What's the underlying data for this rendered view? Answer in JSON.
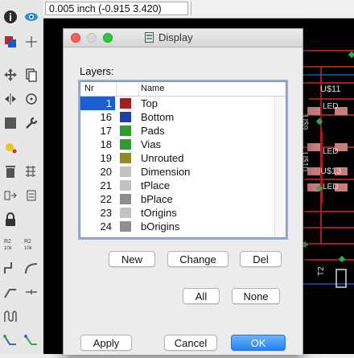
{
  "coordinate_readout": "0.005 inch (-0.915 3.420)",
  "toolbar": {
    "tools": [
      "info-icon",
      "eye-icon",
      "layer-display-icon",
      "mark-icon",
      "move-icon",
      "copy-icon",
      "mirror-icon",
      "rotate-icon",
      "group-icon",
      "change-icon",
      "paste-icon",
      "delete-icon",
      "add-icon",
      "replace-icon",
      "lock-icon",
      "smash-icon",
      "split-icon",
      "optimize-icon",
      "route-icon",
      "ripup-icon",
      "wire-icon",
      "text-icon",
      "arc-icon",
      "circle-icon",
      "meander-icon",
      "autoroute-icon"
    ]
  },
  "board": {
    "labels": [
      "U$11",
      "LED",
      "U$9",
      "LED",
      "U$10",
      "U$13",
      "LED",
      "T2"
    ]
  },
  "dialog": {
    "title": "Display",
    "layers_label": "Layers:",
    "columns": {
      "nr": "Nr",
      "name": "Name"
    },
    "layers": [
      {
        "nr": "1",
        "name": "Top",
        "color": "#a02020",
        "selected": true
      },
      {
        "nr": "16",
        "name": "Bottom",
        "color": "#1c3fb0",
        "selected": false
      },
      {
        "nr": "17",
        "name": "Pads",
        "color": "#2f9a2f",
        "selected": false
      },
      {
        "nr": "18",
        "name": "Vias",
        "color": "#2f9a2f",
        "selected": false
      },
      {
        "nr": "19",
        "name": "Unrouted",
        "color": "#908a20",
        "selected": false
      },
      {
        "nr": "20",
        "name": "Dimension",
        "color": "#c2c2c2",
        "selected": false
      },
      {
        "nr": "21",
        "name": "tPlace",
        "color": "#c2c2c2",
        "selected": false
      },
      {
        "nr": "22",
        "name": "bPlace",
        "color": "#8e8e8e",
        "selected": false
      },
      {
        "nr": "23",
        "name": "tOrigins",
        "color": "#c2c2c2",
        "selected": false
      },
      {
        "nr": "24",
        "name": "bOrigins",
        "color": "#8e8e8e",
        "selected": false
      }
    ],
    "buttons": {
      "new": "New",
      "change": "Change",
      "del": "Del",
      "all": "All",
      "none": "None",
      "apply": "Apply",
      "cancel": "Cancel",
      "ok": "OK"
    }
  }
}
